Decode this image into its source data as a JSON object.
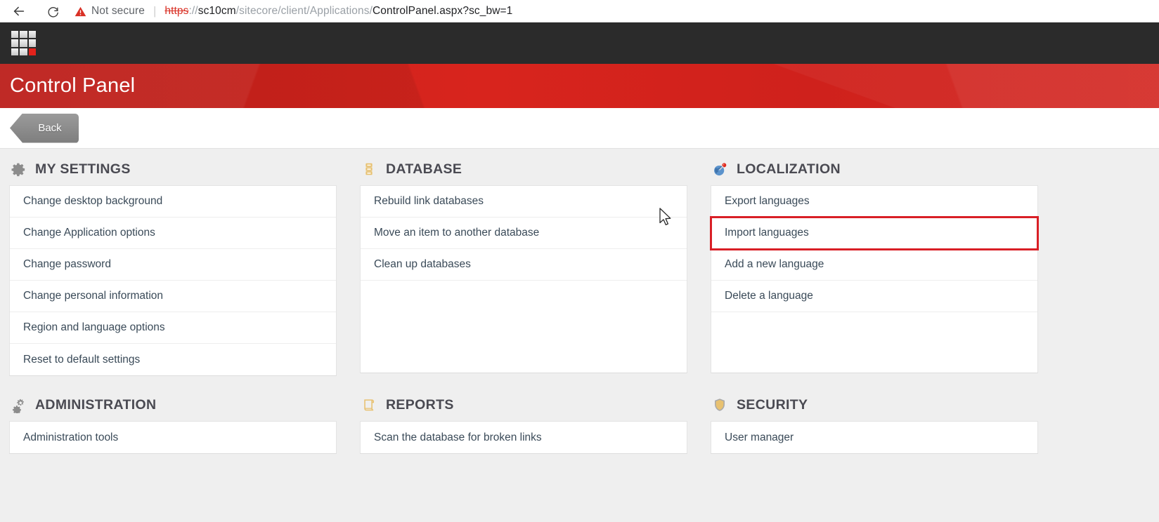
{
  "browser": {
    "back_icon": "back-arrow-icon",
    "reload_icon": "reload-icon",
    "security_icon": "warning-triangle-icon",
    "security_label": "Not secure",
    "separator": "|",
    "url": {
      "scheme": "https",
      "rest_dim_1": "://",
      "host": "sc10cm",
      "path_dim": "/sitecore/client/Applications/",
      "page": "ControlPanel.aspx",
      "query_dim": "?sc_bw=1"
    }
  },
  "topbar": {
    "logo_name": "sitecore-logo"
  },
  "hero": {
    "title": "Control Panel"
  },
  "toolbar": {
    "back_label": "Back"
  },
  "sections": [
    {
      "id": "my-settings",
      "title": "MY SETTINGS",
      "icon": "gear-icon",
      "icon_color": "#8c8c8c",
      "items": [
        "Change desktop background",
        "Change Application options",
        "Change password",
        "Change personal information",
        "Region and language options",
        "Reset to default settings"
      ]
    },
    {
      "id": "database",
      "title": "DATABASE",
      "icon": "database-icon",
      "icon_color": "#e8c170",
      "items": [
        "Rebuild link databases",
        "Move an item to another database",
        "Clean up databases"
      ]
    },
    {
      "id": "localization",
      "title": "LOCALIZATION",
      "icon": "globe-pin-icon",
      "icon_color": "#4a86c5",
      "items": [
        "Export languages",
        "Import languages",
        "Add a new language",
        "Delete a language"
      ],
      "highlighted_item": "Import languages"
    },
    {
      "id": "administration",
      "title": "ADMINISTRATION",
      "icon": "gears-icon",
      "icon_color": "#8c8c8c",
      "items": [
        "Administration tools"
      ]
    },
    {
      "id": "reports",
      "title": "REPORTS",
      "icon": "scroll-icon",
      "icon_color": "#e8c170",
      "items": [
        "Scan the database for broken links"
      ]
    },
    {
      "id": "security",
      "title": "SECURITY",
      "icon": "shield-icon",
      "icon_color": "#e8c170",
      "items": [
        "User manager"
      ]
    }
  ],
  "colors": {
    "brand_red": "#d0211c",
    "highlight_red": "#d91f26",
    "topbar_dark": "#2b2b2b",
    "page_bg": "#efefef",
    "not_secure_red": "#d93025"
  }
}
